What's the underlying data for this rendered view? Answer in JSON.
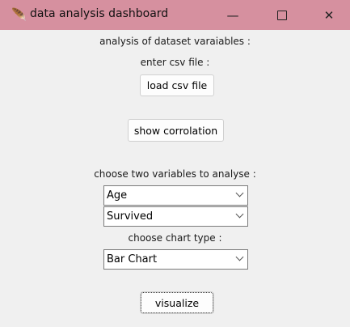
{
  "window": {
    "title": "data analysis dashboard",
    "app_icon": "feather-icon"
  },
  "header_label": "analysis of dataset varaiables :",
  "csv_label": "enter csv file :",
  "load_button": "load csv file",
  "correlation_button": "show corrolation",
  "variables_label": "choose two variables to analyse :",
  "variable1": "Age",
  "variable2": "Survived",
  "chart_label": "choose chart type :",
  "chart_type": "Bar Chart",
  "visualize_button": "visualize"
}
